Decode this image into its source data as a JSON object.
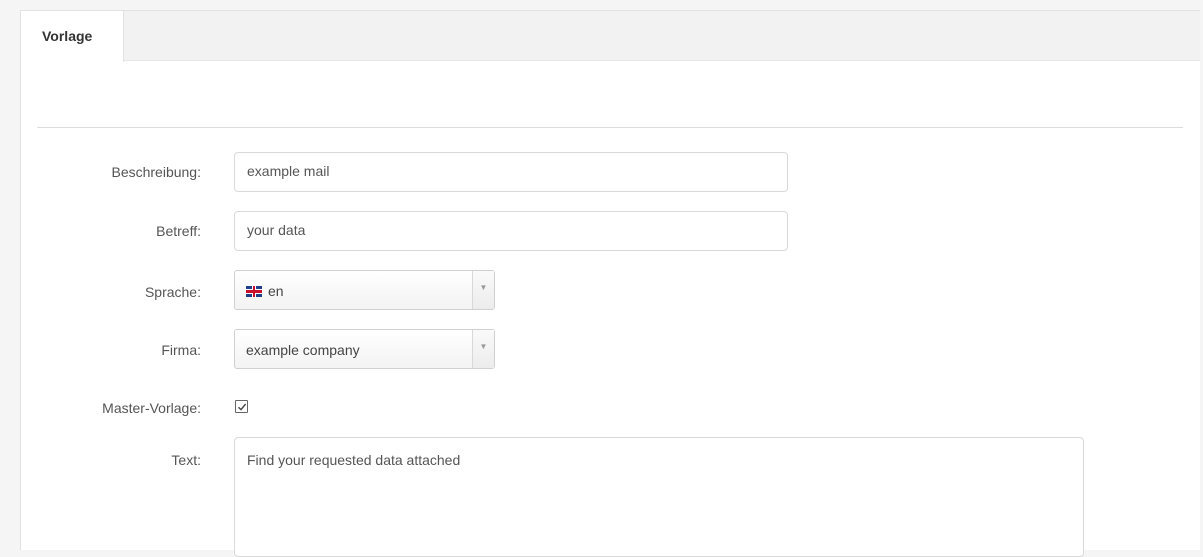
{
  "tabs": [
    {
      "label": "Vorlage",
      "active": true
    }
  ],
  "form": {
    "description": {
      "label": "Beschreibung:",
      "value": "example mail"
    },
    "subject": {
      "label": "Betreff:",
      "value": "your data"
    },
    "language": {
      "label": "Sprache:",
      "value": "en",
      "flag_icon": "uk-flag-icon"
    },
    "company": {
      "label": "Firma:",
      "value": "example company"
    },
    "master_template": {
      "label": "Master-Vorlage:",
      "checked": true
    },
    "text": {
      "label": "Text:",
      "value": "Find your requested data attached"
    }
  },
  "colors": {
    "background": "#f5f5f5",
    "panel": "#ffffff",
    "tabbar": "#f2f2f2",
    "text": "#555555"
  }
}
